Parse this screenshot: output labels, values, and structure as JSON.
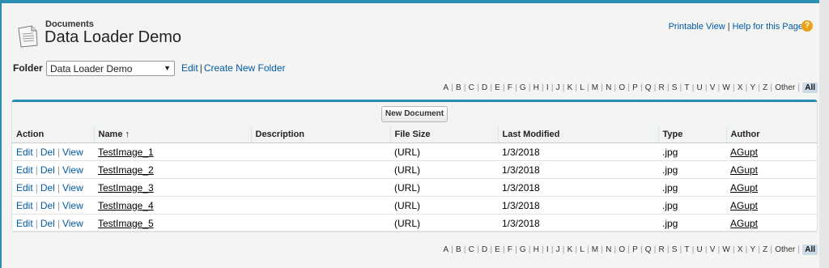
{
  "header": {
    "section": "Documents",
    "title": "Data Loader Demo",
    "links": [
      "Printable View",
      "Help for this Page"
    ],
    "help_icon": "?"
  },
  "folder": {
    "label": "Folder",
    "selected": "Data Loader Demo",
    "links": [
      "Edit",
      "Create New Folder"
    ]
  },
  "alphabet": [
    "A",
    "B",
    "C",
    "D",
    "E",
    "F",
    "G",
    "H",
    "I",
    "J",
    "K",
    "L",
    "M",
    "N",
    "O",
    "P",
    "Q",
    "R",
    "S",
    "T",
    "U",
    "V",
    "W",
    "X",
    "Y",
    "Z",
    "Other",
    "All"
  ],
  "alphabet_active": "All",
  "table": {
    "new_button": "New Document",
    "columns": [
      "Action",
      "Name ↑",
      "Description",
      "File Size",
      "Last Modified",
      "Type",
      "Author"
    ],
    "action_links": [
      "Edit",
      "Del",
      "View"
    ],
    "rows": [
      {
        "name": "TestImage_1",
        "description": "",
        "size": "(URL)",
        "modified": "1/3/2018",
        "type": ".jpg",
        "author": "AGupt"
      },
      {
        "name": "TestImage_2",
        "description": "",
        "size": "(URL)",
        "modified": "1/3/2018",
        "type": ".jpg",
        "author": "AGupt"
      },
      {
        "name": "TestImage_3",
        "description": "",
        "size": "(URL)",
        "modified": "1/3/2018",
        "type": ".jpg",
        "author": "AGupt"
      },
      {
        "name": "TestImage_4",
        "description": "",
        "size": "(URL)",
        "modified": "1/3/2018",
        "type": ".jpg",
        "author": "AGupt"
      },
      {
        "name": "TestImage_5",
        "description": "",
        "size": "(URL)",
        "modified": "1/3/2018",
        "type": ".jpg",
        "author": "AGupt"
      }
    ]
  },
  "colors": {
    "accent": "#2a8fb3",
    "link": "#015ba7",
    "help": "#e8a317"
  }
}
